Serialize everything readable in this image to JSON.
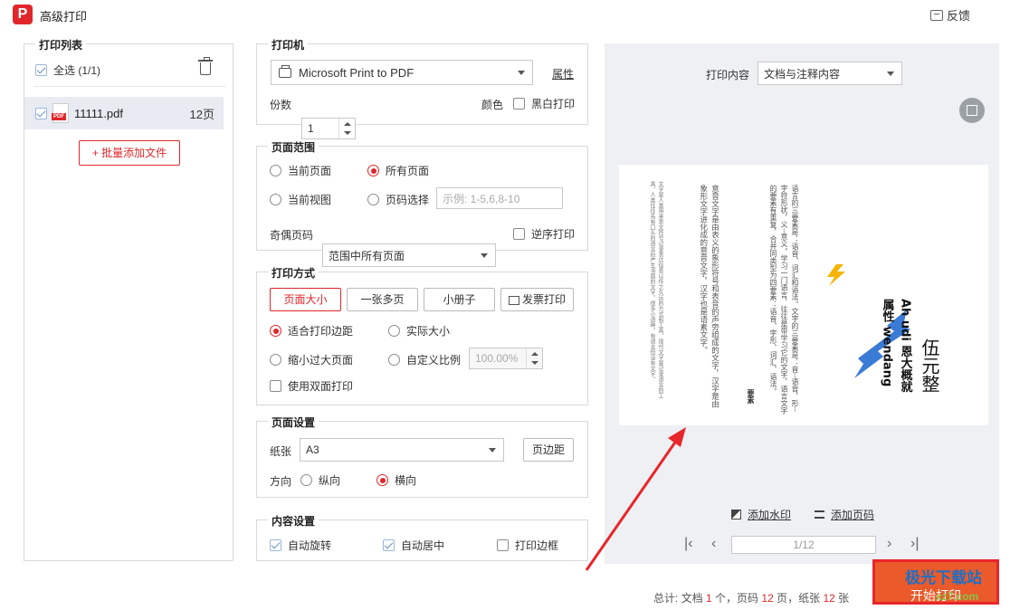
{
  "window": {
    "title": "高级打印",
    "logo_letter": "P",
    "feedback_label": "反馈"
  },
  "print_list": {
    "legend": "打印列表",
    "select_all_label": "全选 (1/1)",
    "file": {
      "name": "11111.pdf",
      "pages": "12页",
      "badge": "PDF"
    },
    "add_files_label": "+ 批量添加文件"
  },
  "printer": {
    "legend": "打印机",
    "selected": "Microsoft Print to PDF",
    "properties_label": "属性",
    "copies_label": "份数",
    "copies_value": "1",
    "color_label": "颜色",
    "bw_label": "黑白打印"
  },
  "page_range": {
    "legend": "页面范围",
    "current_page": "当前页面",
    "all_pages": "所有页面",
    "current_view": "当前视图",
    "page_select": "页码选择",
    "page_select_placeholder": "示例: 1-5,6,8-10",
    "odd_even_label": "奇偶页码",
    "odd_even_value": "范围中所有页面",
    "reverse_label": "逆序打印"
  },
  "print_mode": {
    "legend": "打印方式",
    "tabs": [
      "页面大小",
      "一张多页",
      "小册子",
      "发票打印"
    ],
    "fit_margin": "适合打印边距",
    "actual_size": "实际大小",
    "shrink_large": "缩小过大页面",
    "custom_scale": "自定义比例",
    "custom_scale_value": "100.00%",
    "duplex": "使用双面打印"
  },
  "page_setup": {
    "legend": "页面设置",
    "paper_label": "纸张",
    "paper_value": "A3",
    "margins_label": "页边距",
    "orientation_label": "方向",
    "portrait": "纵向",
    "landscape": "横向"
  },
  "content_setup": {
    "legend": "内容设置",
    "auto_rotate": "自动旋转",
    "auto_center": "自动居中",
    "print_border": "打印边框"
  },
  "preview": {
    "content_label": "打印内容",
    "content_value": "文档与注释内容",
    "add_watermark": "添加水印",
    "add_page_number": "添加页码",
    "page_indicator": "1/12",
    "doc_text": {
      "col1": "文字是人类用来表文符号记录表达信息以传之久远的方式和工具。现代文字是记录语言的工具。人类往往先有口头的语言后产生书面的文字，很多小语种，有语言但没有文字。",
      "col2": "意音文字是由表义的象形符号和表音的声旁组成的文字，汉字是由象形文字进化成的意音文字，汉字也是语素文字。",
      "col3": "要素",
      "col4": "语言的三要素是：语音、词汇和语法。文字的三要素是：音--语音，形--字符形状，义--意义。学习一门语言，往往是带学习它的文字，语言文字的要素有重复，合并同类型为四要素：语音、字形、词汇、语法。",
      "col5": "属性 wendang",
      "col6": "Ah udi 恩大概就",
      "col7": "伍元整"
    }
  },
  "summary": {
    "prefix": "总计: 文档",
    "docs": "1",
    "docs_unit": "个，页码",
    "pages": "12",
    "pages_unit": "页，纸张",
    "sheets": "12",
    "sheets_unit": "张"
  },
  "start_button": "开始打印",
  "watermark": {
    "logo_text": "极光下载站",
    "url": "xz7.com"
  },
  "colors": {
    "accent": "#e0262b",
    "start_button": "#ea5a2a",
    "preview_bg": "#eef0f3"
  }
}
